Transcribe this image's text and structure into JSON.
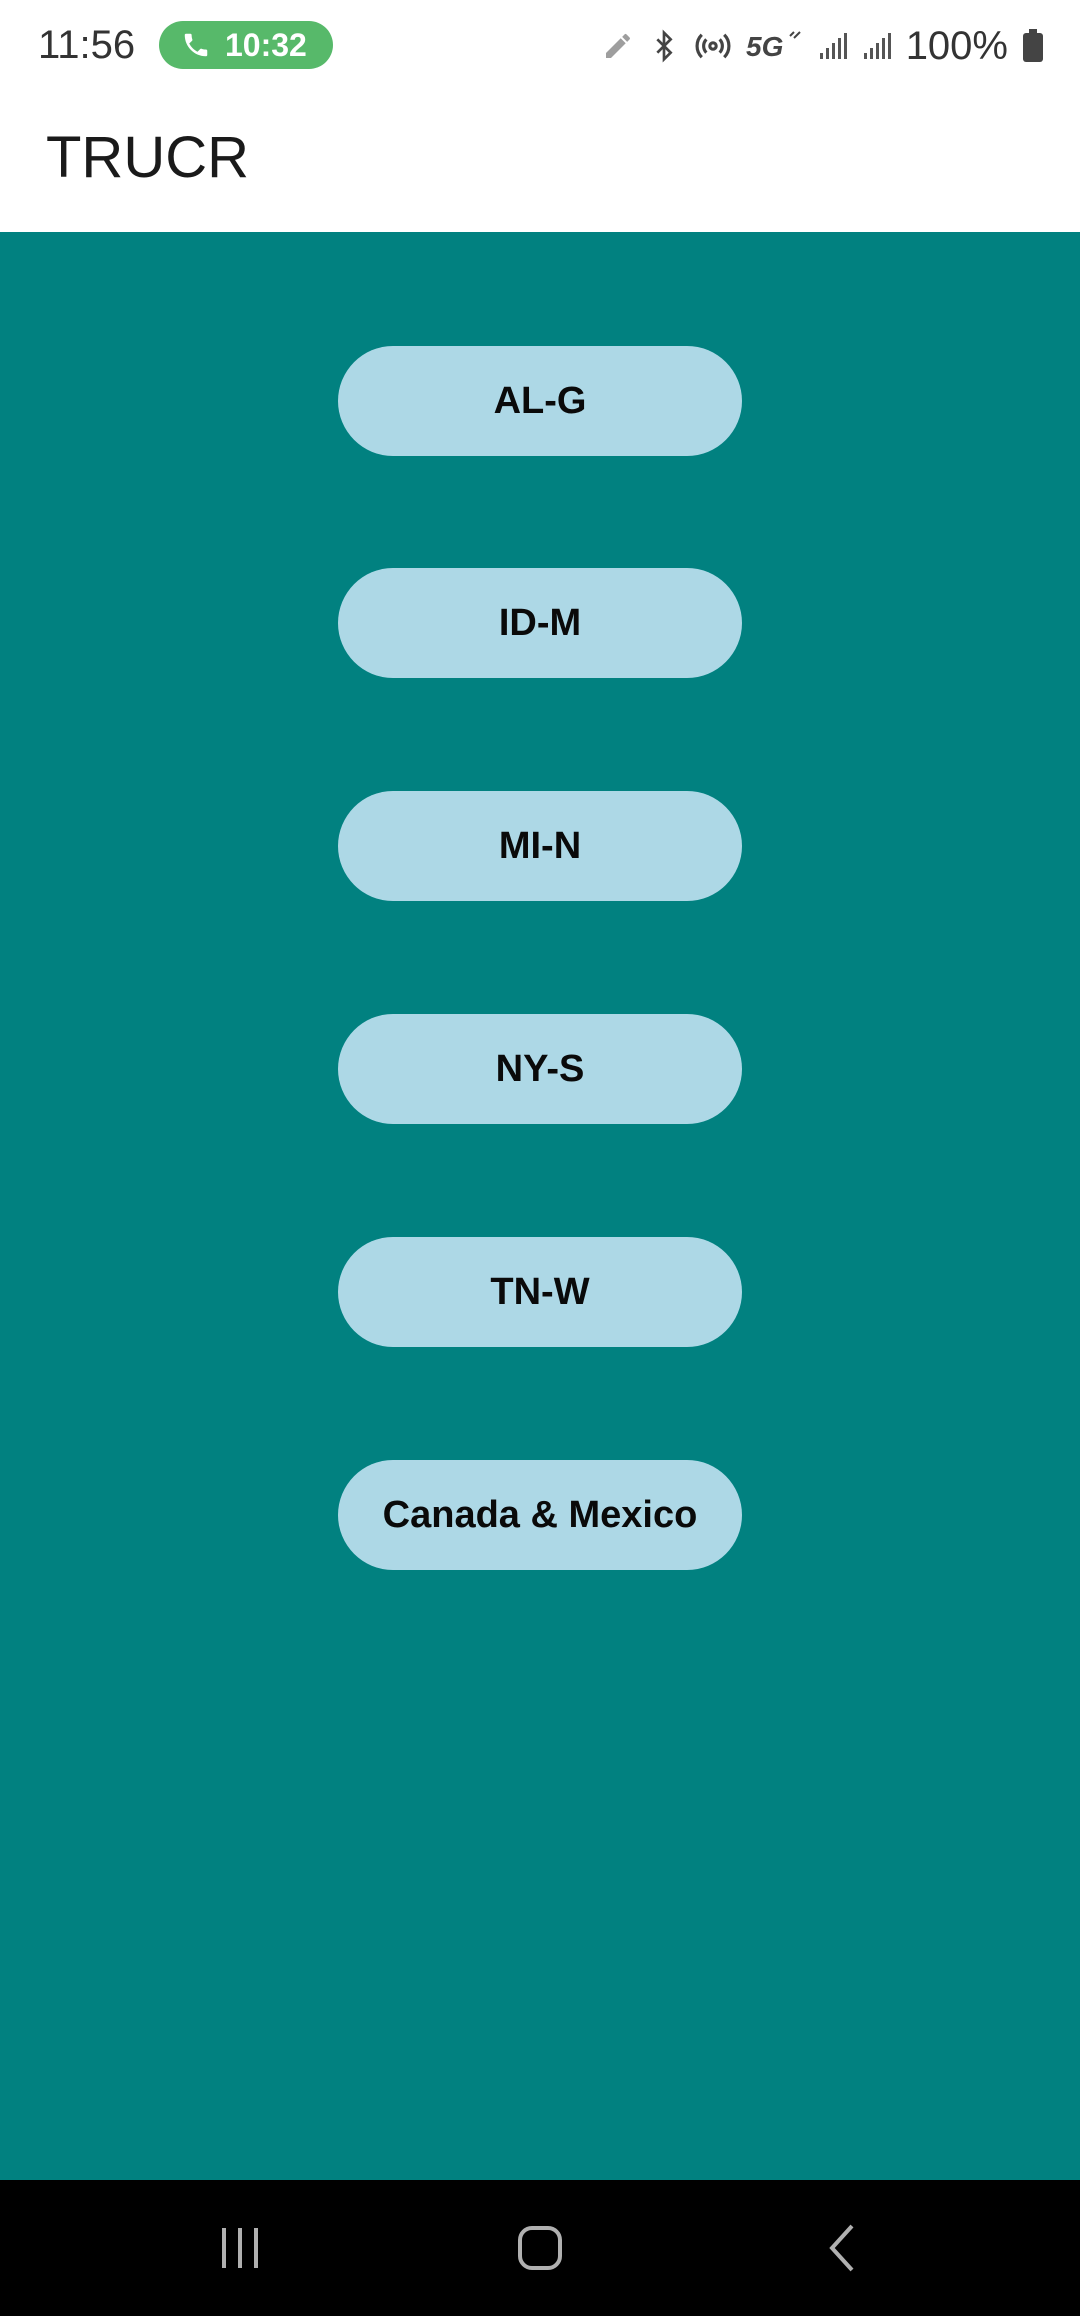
{
  "status_bar": {
    "time": "11:56",
    "call_timer": "10:32",
    "battery": "100%",
    "icons": [
      "pencil-icon",
      "bluetooth-icon",
      "hotspot-icon",
      "5g-icon",
      "signal-icon",
      "signal-icon",
      "battery-icon"
    ],
    "call_color": "#57b96a"
  },
  "app_bar": {
    "title": "TRUCR"
  },
  "regions": {
    "items": [
      {
        "label": "AL-G"
      },
      {
        "label": "ID-M"
      },
      {
        "label": "MI-N"
      },
      {
        "label": "NY-S"
      },
      {
        "label": "TN-W"
      },
      {
        "label": "Canada & Mexico"
      }
    ]
  },
  "nav_bar": {
    "icons": [
      "recents-icon",
      "home-icon",
      "back-icon"
    ]
  },
  "colors": {
    "background": "#018180",
    "button": "#add8e6",
    "nav": "#000000"
  }
}
